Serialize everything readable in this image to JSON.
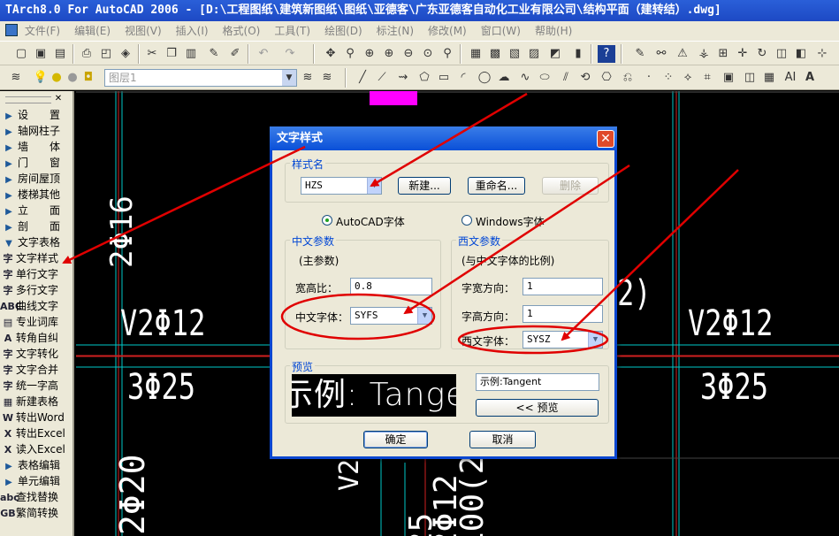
{
  "window_title": "TArch8.0 For AutoCAD 2006 - [D:\\工程图纸\\建筑新图纸\\图纸\\亚德客\\广东亚德客自动化工业有限公司\\结构平面（建转结）.dwg]",
  "menu": [
    "文件(F)",
    "编辑(E)",
    "视图(V)",
    "插入(I)",
    "格式(O)",
    "工具(T)",
    "绘图(D)",
    "标注(N)",
    "修改(M)",
    "窗口(W)",
    "帮助(H)"
  ],
  "layer": {
    "value": "图层1"
  },
  "left_panel": {
    "items": [
      {
        "label": "设　　置",
        "type": "arrow"
      },
      {
        "label": "轴网柱子",
        "type": "arrow"
      },
      {
        "label": "墙　　体",
        "type": "arrow"
      },
      {
        "label": "门　　窗",
        "type": "arrow"
      },
      {
        "label": "房间屋顶",
        "type": "arrow"
      },
      {
        "label": "楼梯其他",
        "type": "arrow"
      },
      {
        "label": "立　　面",
        "type": "arrow"
      },
      {
        "label": "剖　　面",
        "type": "arrow"
      },
      {
        "label": "文字表格",
        "type": "open"
      },
      {
        "label": "文字样式",
        "type": "icon",
        "icon": "字"
      },
      {
        "label": "单行文字",
        "type": "icon",
        "icon": "字"
      },
      {
        "label": "多行文字",
        "type": "icon",
        "icon": "字"
      },
      {
        "label": "曲线文字",
        "type": "icon",
        "icon": "ABC"
      },
      {
        "label": "专业词库",
        "type": "icon",
        "icon": "▤"
      },
      {
        "label": "转角自纠",
        "type": "icon",
        "icon": "A"
      },
      {
        "label": "文字转化",
        "type": "icon",
        "icon": "字"
      },
      {
        "label": "文字合并",
        "type": "icon",
        "icon": "字"
      },
      {
        "label": "统一字高",
        "type": "icon",
        "icon": "字"
      },
      {
        "label": "新建表格",
        "type": "icon",
        "icon": "▦"
      },
      {
        "label": "转出Word",
        "type": "icon",
        "icon": "W"
      },
      {
        "label": "转出Excel",
        "type": "icon",
        "icon": "X"
      },
      {
        "label": "读入Excel",
        "type": "icon",
        "icon": "X"
      },
      {
        "label": "表格编辑",
        "type": "arrow"
      },
      {
        "label": "单元编辑",
        "type": "arrow"
      },
      {
        "label": "查找替换",
        "type": "icon",
        "icon": "abc"
      },
      {
        "label": "繁简转换",
        "type": "icon",
        "icon": "GB"
      }
    ]
  },
  "canvas_texts": [
    {
      "text": "2Φ16",
      "rot": true
    },
    {
      "text": "V2Φ12",
      "rot": false
    },
    {
      "text": "3Φ25",
      "rot": false
    },
    {
      "text": "V2Φ12",
      "rot": false
    },
    {
      "text": "3Φ25",
      "rot": false
    },
    {
      "text": "2)",
      "rot": false
    },
    {
      "text": "2Φ20",
      "rot": true
    },
    {
      "text": "V2",
      "rot": true
    },
    {
      "text": "2Φ12",
      "rot": true
    },
    {
      "text": "100(2",
      "rot": true
    },
    {
      "text": "25",
      "rot": true
    }
  ],
  "dialog": {
    "title": "文字样式",
    "style_group": "样式名",
    "style_value": "HZS",
    "new_button": "新建...",
    "rename_button": "重命名...",
    "delete_button": "删除",
    "radio_autocad": "AutoCAD字体",
    "radio_windows": "Windows字体",
    "cn_group": "中文参数",
    "cn_note": "(主参数)",
    "width_ratio_label": "宽高比：",
    "width_ratio_value": "0.8",
    "cn_font_label": "中文字体：",
    "cn_font_value": "SYFS",
    "west_group": "西文参数",
    "west_note": "(与中文字体的比例)",
    "char_width_label": "字宽方向：",
    "char_width_value": "1",
    "char_height_label": "字高方向：",
    "char_height_value": "1",
    "west_font_label": "西文字体：",
    "west_font_value": "SYSZ",
    "preview_group": "预览",
    "preview_text": "示例: Tangen",
    "sample_value": "示例:Tangent",
    "preview_button": "<< 预览",
    "ok_button": "确定",
    "cancel_button": "取消"
  },
  "colors": {
    "annotation": "#e00000",
    "accent": "#0a46d0",
    "cad_bg": "#000000",
    "cad_line": "#00c8c8"
  }
}
